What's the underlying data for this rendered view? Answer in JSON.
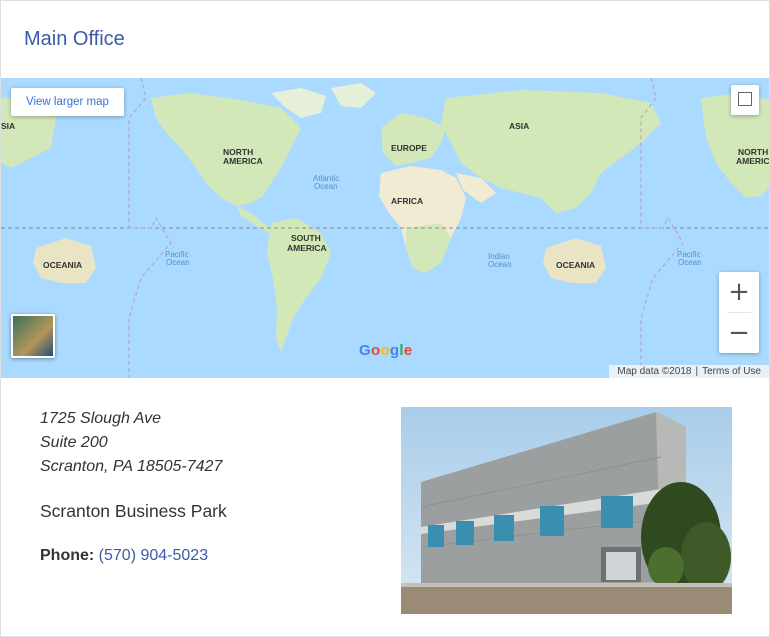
{
  "header": {
    "title": "Main Office"
  },
  "map": {
    "view_larger_label": "View larger map",
    "zoom_in_symbol": "+",
    "zoom_out_symbol": "−",
    "map_data_text": "Map data ©2018",
    "terms_text": "Terms of Use",
    "logo_text": "Google",
    "continent_labels": {
      "asia_left": "SIA",
      "north_america": [
        "NORTH",
        "AMERICA"
      ],
      "europe": "EUROPE",
      "asia": "ASIA",
      "north_america_right": [
        "NORTH",
        "AMERICA"
      ],
      "africa": "AFRICA",
      "south_america": [
        "SOUTH",
        "AMERICA"
      ],
      "oceania_left": "OCEANIA",
      "oceania_right": "OCEANIA"
    },
    "ocean_labels": {
      "atlantic": [
        "Atlantic",
        "Ocean"
      ],
      "pacific_left": [
        "Pacific",
        "Ocean"
      ],
      "indian": [
        "Indian",
        "Ocean"
      ],
      "pacific_right": [
        "Pacific",
        "Ocean"
      ]
    },
    "colors": {
      "water": "#aadaff",
      "land": "#d3e8b8",
      "desert": "#f0ebd2"
    }
  },
  "address": {
    "line1": "1725 Slough Ave",
    "line2": "Suite 200",
    "line3": "Scranton, PA 18505-7427"
  },
  "business_park": "Scranton Business Park",
  "phone": {
    "label": "Phone:",
    "number": "(570) 904-5023"
  },
  "colors": {
    "accent": "#3a5aa8",
    "text": "#333333"
  }
}
